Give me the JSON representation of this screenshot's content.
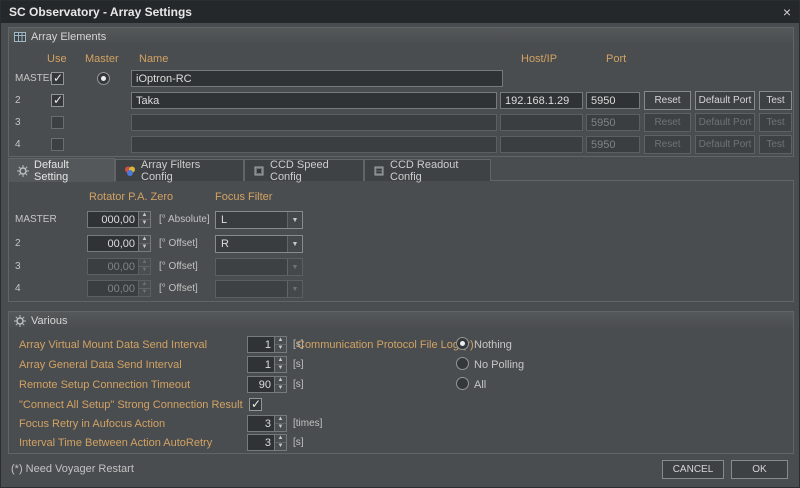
{
  "window": {
    "title": "SC Observatory - Array Settings",
    "close_glyph": "×"
  },
  "array_elements": {
    "title": "Array Elements",
    "headers": {
      "use": "Use",
      "master": "Master",
      "name": "Name",
      "host": "Host/IP",
      "port": "Port"
    },
    "buttons": {
      "reset": "Reset",
      "default_port": "Default Port",
      "test": "Test"
    },
    "rows": [
      {
        "label": "MASTER",
        "use": true,
        "master": true,
        "name": "iOptron-RC",
        "disabled": false
      },
      {
        "label": "2",
        "use": true,
        "name": "Taka",
        "host": "192.168.1.29",
        "port": "5950",
        "disabled": false
      },
      {
        "label": "3",
        "use": false,
        "name": "",
        "host": "",
        "port": "5950",
        "disabled": true
      },
      {
        "label": "4",
        "use": false,
        "name": "",
        "host": "",
        "port": "5950",
        "disabled": true
      }
    ]
  },
  "tabs": [
    {
      "label": "Default Setting",
      "active": true
    },
    {
      "label": "Array Filters Config",
      "active": false
    },
    {
      "label": "CCD Speed Config",
      "active": false
    },
    {
      "label": "CCD Readout Config",
      "active": false
    }
  ],
  "default_setting": {
    "columns": {
      "rotator": "Rotator P.A. Zero",
      "focus": "Focus Filter"
    },
    "rows": [
      {
        "label": "MASTER",
        "value": "000,00",
        "unit": "[° Absolute]",
        "filter": "L",
        "disabled": false
      },
      {
        "label": "2",
        "value": "00,00",
        "unit": "[° Offset]",
        "filter": "R",
        "disabled": false
      },
      {
        "label": "3",
        "value": "00,00",
        "unit": "[° Offset]",
        "filter": "",
        "disabled": true
      },
      {
        "label": "4",
        "value": "00,00",
        "unit": "[° Offset]",
        "filter": "",
        "disabled": true
      }
    ]
  },
  "various": {
    "title": "Various",
    "fields": [
      {
        "label": "Array Virtual Mount Data Send Interval",
        "value": "1",
        "unit": "[s]"
      },
      {
        "label": "Array General Data Send Interval",
        "value": "1",
        "unit": "[s]"
      },
      {
        "label": "Remote Setup Connection Timeout",
        "value": "90",
        "unit": "[s]"
      },
      {
        "label": "\"Connect All Setup\" Strong Connection Result",
        "checked": true
      },
      {
        "label": "Focus Retry in Aufocus Action",
        "value": "3",
        "unit": "[times]"
      },
      {
        "label": "Interval Time Between Action AutoRetry",
        "value": "3",
        "unit": "[s]"
      }
    ],
    "log": {
      "label": "Communication Protocol File Log (*)",
      "options": [
        {
          "label": "Nothing",
          "selected": true
        },
        {
          "label": "No Polling",
          "selected": false
        },
        {
          "label": "All",
          "selected": false
        }
      ]
    }
  },
  "footer": {
    "note": "(*) Need Voyager Restart",
    "cancel": "CANCEL",
    "ok": "OK"
  }
}
